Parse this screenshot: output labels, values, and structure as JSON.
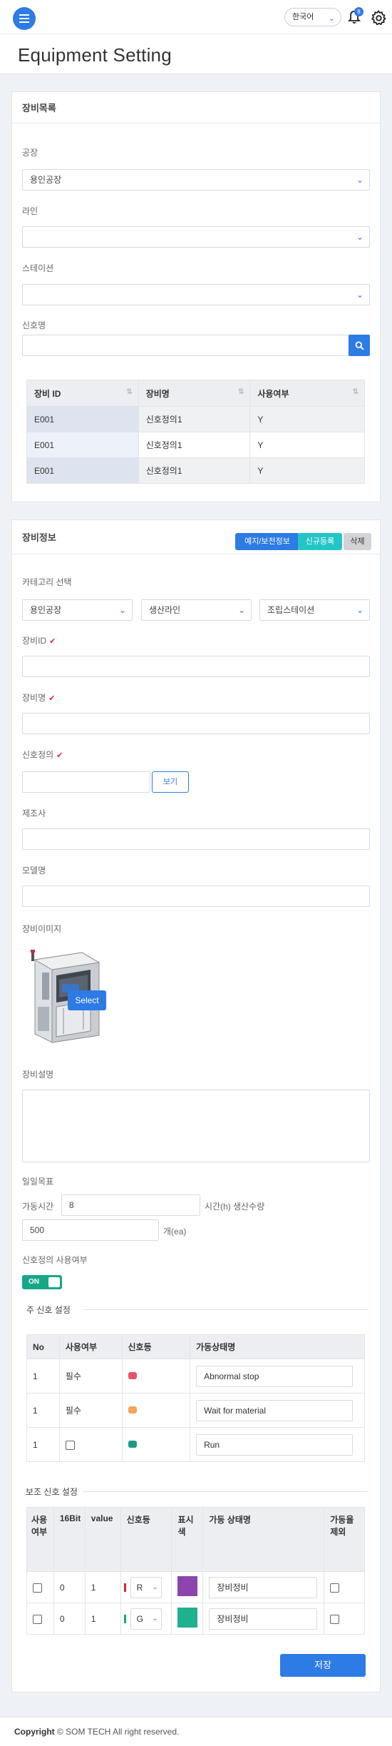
{
  "header": {
    "language": "한국어",
    "notification_count": "8"
  },
  "page_title": "Equipment Setting",
  "equipment_list": {
    "title": "장비목록",
    "factory_label": "공장",
    "factory_value": "용인공장",
    "line_label": "라인",
    "line_value": "",
    "station_label": "스테이션",
    "station_value": "",
    "signal_label": "신호명",
    "signal_value": "",
    "columns": [
      "장비 ID",
      "장비명",
      "사용여부"
    ],
    "rows": [
      [
        "E001",
        "신호정의1",
        "Y"
      ],
      [
        "E001",
        "신호정의1",
        "Y"
      ],
      [
        "E001",
        "신호정의1",
        "Y"
      ]
    ]
  },
  "equipment_info": {
    "title": "장비정보",
    "buttons": {
      "maintenance": "예지/보전정보",
      "new": "신규등록",
      "delete": "삭제"
    },
    "category_label": "카테고리 선택",
    "category_values": [
      "용인공장",
      "생산라인",
      "조립스테이션"
    ],
    "equip_id_label": "장비ID",
    "equip_name_label": "장비명",
    "signal_def_label": "신호정의",
    "view_button": "보기",
    "maker_label": "제조사",
    "model_label": "모델명",
    "image_label": "장비이미지",
    "select_button": "Select",
    "desc_label": "장비설명",
    "daily_goal_label": "일일목표",
    "run_time_label": "가동시간",
    "run_time_value": "8",
    "time_unit_label": "시간(h) 생산수량",
    "qty_value": "500",
    "qty_unit": "개(ea)",
    "signal_use_label": "신호정의 사용여부",
    "toggle_label": "ON",
    "main_signal_title": "주 신호 설정",
    "main_columns": [
      "No",
      "사용여부",
      "신호등",
      "가동상태명"
    ],
    "main_rows": [
      {
        "no": "1",
        "use": "필수",
        "color": "#e8536b",
        "status": "Abnormal stop"
      },
      {
        "no": "1",
        "use": "필수",
        "color": "#f2a65a",
        "status": "Wait for material"
      },
      {
        "no": "1",
        "use": "",
        "color": "#199a86",
        "status": "Run"
      }
    ],
    "sub_signal_title": "보조 신호 설정",
    "sub_columns": [
      "사용여부",
      "16Bit",
      "value",
      "신호등",
      "표시색",
      "가동 상태명",
      "가동율 제외"
    ],
    "sub_rows": [
      {
        "bit": "0",
        "value": "1",
        "lamp_color": "#d9263a",
        "lamp_select": "R",
        "display_color": "#8e44ad",
        "status": "장비정비"
      },
      {
        "bit": "0",
        "value": "1",
        "lamp_color": "#18a689",
        "lamp_select": "G",
        "display_color": "#1fb08f",
        "status": "장비정비"
      }
    ],
    "save_button": "저장"
  },
  "footer": {
    "copyright_bold": "Copyright",
    "copyright_rest": " © SOM TECH All right reserved."
  }
}
